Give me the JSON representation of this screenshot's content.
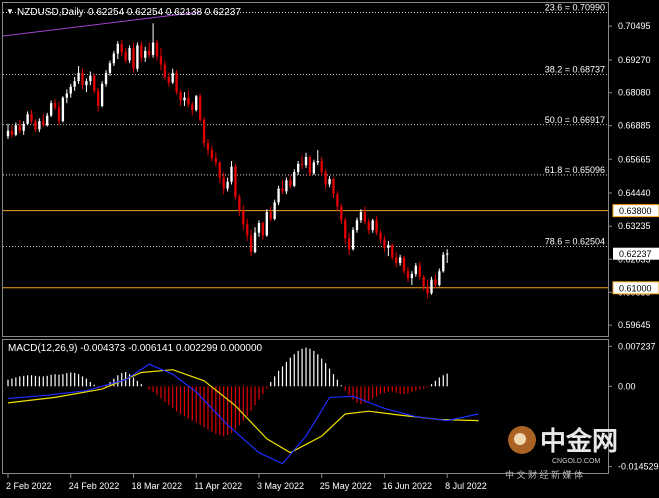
{
  "header": {
    "symbol_label": "NZDUSD,Daily",
    "ohlc_label": "0.62254 0.62254 0.62138 0.62237"
  },
  "macd_header": {
    "label": "MACD(12,26,9) -0.004373 -0.006141 0.002299 0.000000"
  },
  "colors": {
    "bull": "#ffffff",
    "bear": "#e00000",
    "fib_line": "#ffffff",
    "hline": "#f5a623",
    "macd_line": "#1e2cff",
    "signal_line": "#f0e000",
    "top_line": "#a040d0",
    "label_box_bg": "#ffffff",
    "label_box_text": "#000000",
    "current_price_box_bg": "#ffffff"
  },
  "fib_levels": [
    {
      "label": "23.6 = 0.70990",
      "price": 0.7099
    },
    {
      "label": "38.2 = 0.68737",
      "price": 0.68737
    },
    {
      "label": "50.0 = 0.66917",
      "price": 0.66917
    },
    {
      "label": "61.8 = 0.65096",
      "price": 0.65096
    },
    {
      "label": "78.6 = 0.62504",
      "price": 0.62504
    }
  ],
  "horizontal_lines": [
    {
      "label": "0.63800",
      "price": 0.638
    },
    {
      "label": "0.61000",
      "price": 0.61
    }
  ],
  "current_price": {
    "label": "0.62237",
    "price": 0.62237
  },
  "price_axis_ticks": [
    {
      "label": "0.70495",
      "price": 0.70495
    },
    {
      "label": "0.69270",
      "price": 0.6927
    },
    {
      "label": "0.68080",
      "price": 0.6808
    },
    {
      "label": "0.66885",
      "price": 0.66885
    },
    {
      "label": "0.65665",
      "price": 0.65665
    },
    {
      "label": "0.64440",
      "price": 0.6444
    },
    {
      "label": "0.63235",
      "price": 0.63235
    },
    {
      "label": "0.62035",
      "price": 0.62035
    },
    {
      "label": "0.60835",
      "price": 0.60835
    },
    {
      "label": "0.59645",
      "price": 0.59645
    }
  ],
  "macd_axis_ticks": [
    {
      "label": "0.007237",
      "value": 0.007237
    },
    {
      "label": "0.00",
      "value": 0.0
    },
    {
      "label": "-0.014529",
      "value": -0.014529
    }
  ],
  "date_ticks": [
    {
      "label": "2 Feb 2022",
      "index": 0
    },
    {
      "label": "24 Feb 2022",
      "index": 16
    },
    {
      "label": "18 Mar 2022",
      "index": 32
    },
    {
      "label": "11 Apr 2022",
      "index": 48
    },
    {
      "label": "3 May 2022",
      "index": 64
    },
    {
      "label": "25 May 2022",
      "index": 80
    },
    {
      "label": "16 Jun 2022",
      "index": 96
    },
    {
      "label": "8 Jul 2022",
      "index": 112
    }
  ],
  "watermark": {
    "brand": "中金网",
    "site": "CNGOLD.COM",
    "tagline": "中 文 财 经 新 媒 体"
  },
  "chart_data": {
    "type": "candlestick",
    "title": "NZDUSD,Daily",
    "price_range": [
      0.5925,
      0.713
    ],
    "macd_range": [
      -0.0155,
      0.0082
    ],
    "candles": [
      [
        0.665,
        0.6695,
        0.664,
        0.667
      ],
      [
        0.667,
        0.669,
        0.6645,
        0.6655
      ],
      [
        0.6655,
        0.67,
        0.665,
        0.669
      ],
      [
        0.669,
        0.671,
        0.666,
        0.667
      ],
      [
        0.667,
        0.6705,
        0.6655,
        0.6695
      ],
      [
        0.6695,
        0.674,
        0.669,
        0.673
      ],
      [
        0.673,
        0.6745,
        0.6695,
        0.6705
      ],
      [
        0.6705,
        0.6712,
        0.6665,
        0.6675
      ],
      [
        0.6675,
        0.6715,
        0.6665,
        0.6705
      ],
      [
        0.6705,
        0.673,
        0.6685,
        0.669
      ],
      [
        0.669,
        0.6735,
        0.6685,
        0.6725
      ],
      [
        0.6725,
        0.678,
        0.672,
        0.677
      ],
      [
        0.677,
        0.6785,
        0.6745,
        0.6755
      ],
      [
        0.6755,
        0.6775,
        0.669,
        0.6705
      ],
      [
        0.6705,
        0.6795,
        0.67,
        0.679
      ],
      [
        0.679,
        0.682,
        0.677,
        0.6805
      ],
      [
        0.6805,
        0.684,
        0.679,
        0.683
      ],
      [
        0.683,
        0.6865,
        0.6815,
        0.685
      ],
      [
        0.685,
        0.6905,
        0.684,
        0.688
      ],
      [
        0.688,
        0.6895,
        0.682,
        0.6835
      ],
      [
        0.6835,
        0.686,
        0.681,
        0.685
      ],
      [
        0.685,
        0.6885,
        0.6835,
        0.687
      ],
      [
        0.687,
        0.6875,
        0.6805,
        0.6815
      ],
      [
        0.6815,
        0.6825,
        0.674,
        0.676
      ],
      [
        0.676,
        0.685,
        0.6755,
        0.684
      ],
      [
        0.684,
        0.689,
        0.683,
        0.688
      ],
      [
        0.688,
        0.6925,
        0.687,
        0.6915
      ],
      [
        0.6915,
        0.696,
        0.6905,
        0.695
      ],
      [
        0.695,
        0.6995,
        0.693,
        0.6985
      ],
      [
        0.6985,
        0.7,
        0.694,
        0.6955
      ],
      [
        0.6955,
        0.697,
        0.6915,
        0.6925
      ],
      [
        0.6925,
        0.698,
        0.6915,
        0.697
      ],
      [
        0.697,
        0.699,
        0.688,
        0.6895
      ],
      [
        0.6895,
        0.699,
        0.6885,
        0.698
      ],
      [
        0.698,
        0.6995,
        0.692,
        0.6935
      ],
      [
        0.6935,
        0.6975,
        0.692,
        0.696
      ],
      [
        0.696,
        0.699,
        0.6935,
        0.6945
      ],
      [
        0.6945,
        0.706,
        0.6935,
        0.699
      ],
      [
        0.699,
        0.7,
        0.6925,
        0.694
      ],
      [
        0.694,
        0.697,
        0.689,
        0.691
      ],
      [
        0.691,
        0.6925,
        0.6855,
        0.6865
      ],
      [
        0.6865,
        0.688,
        0.683,
        0.6845
      ],
      [
        0.6845,
        0.6895,
        0.684,
        0.688
      ],
      [
        0.688,
        0.689,
        0.68,
        0.681
      ],
      [
        0.681,
        0.682,
        0.676,
        0.678
      ],
      [
        0.678,
        0.681,
        0.676,
        0.679
      ],
      [
        0.679,
        0.6815,
        0.6755,
        0.6765
      ],
      [
        0.6765,
        0.6775,
        0.6725,
        0.6745
      ],
      [
        0.6745,
        0.68,
        0.674,
        0.6795
      ],
      [
        0.6795,
        0.6805,
        0.67,
        0.671
      ],
      [
        0.671,
        0.672,
        0.661,
        0.6625
      ],
      [
        0.6625,
        0.664,
        0.658,
        0.66
      ],
      [
        0.66,
        0.6615,
        0.656,
        0.657
      ],
      [
        0.657,
        0.659,
        0.654,
        0.6555
      ],
      [
        0.6555,
        0.656,
        0.648,
        0.65
      ],
      [
        0.65,
        0.652,
        0.644,
        0.646
      ],
      [
        0.646,
        0.65,
        0.645,
        0.6485
      ],
      [
        0.6485,
        0.656,
        0.6475,
        0.654
      ],
      [
        0.654,
        0.655,
        0.642,
        0.643
      ],
      [
        0.643,
        0.644,
        0.636,
        0.638
      ],
      [
        0.638,
        0.64,
        0.631,
        0.633
      ],
      [
        0.633,
        0.635,
        0.627,
        0.629
      ],
      [
        0.629,
        0.631,
        0.6215,
        0.623
      ],
      [
        0.623,
        0.632,
        0.6225,
        0.63
      ],
      [
        0.63,
        0.6345,
        0.6285,
        0.6335
      ],
      [
        0.6335,
        0.634,
        0.6275,
        0.629
      ],
      [
        0.629,
        0.6385,
        0.6285,
        0.6375
      ],
      [
        0.6375,
        0.6395,
        0.634,
        0.635
      ],
      [
        0.635,
        0.642,
        0.6345,
        0.641
      ],
      [
        0.641,
        0.647,
        0.64,
        0.646
      ],
      [
        0.646,
        0.649,
        0.644,
        0.645
      ],
      [
        0.645,
        0.65,
        0.644,
        0.649
      ],
      [
        0.649,
        0.651,
        0.646,
        0.647
      ],
      [
        0.647,
        0.653,
        0.6465,
        0.652
      ],
      [
        0.652,
        0.656,
        0.651,
        0.655
      ],
      [
        0.655,
        0.658,
        0.653,
        0.6545
      ],
      [
        0.6545,
        0.659,
        0.6535,
        0.6575
      ],
      [
        0.6575,
        0.658,
        0.6505,
        0.6515
      ],
      [
        0.6515,
        0.6565,
        0.651,
        0.6555
      ],
      [
        0.6555,
        0.66,
        0.6545,
        0.656
      ],
      [
        0.656,
        0.6575,
        0.6505,
        0.652
      ],
      [
        0.652,
        0.653,
        0.646,
        0.6475
      ],
      [
        0.6475,
        0.6505,
        0.6465,
        0.6495
      ],
      [
        0.6495,
        0.65,
        0.6425,
        0.644
      ],
      [
        0.644,
        0.645,
        0.638,
        0.6395
      ],
      [
        0.6395,
        0.6405,
        0.633,
        0.6345
      ],
      [
        0.6345,
        0.6355,
        0.626,
        0.628
      ],
      [
        0.628,
        0.63,
        0.622,
        0.624
      ],
      [
        0.624,
        0.632,
        0.6235,
        0.631
      ],
      [
        0.631,
        0.6355,
        0.63,
        0.6345
      ],
      [
        0.6345,
        0.6385,
        0.6335,
        0.6375
      ],
      [
        0.6375,
        0.6395,
        0.633,
        0.634
      ],
      [
        0.634,
        0.635,
        0.6295,
        0.631
      ],
      [
        0.631,
        0.635,
        0.63,
        0.6345
      ],
      [
        0.6345,
        0.636,
        0.629,
        0.63
      ],
      [
        0.63,
        0.631,
        0.626,
        0.6275
      ],
      [
        0.6275,
        0.629,
        0.623,
        0.6245
      ],
      [
        0.6245,
        0.627,
        0.6215,
        0.6255
      ],
      [
        0.6255,
        0.626,
        0.62,
        0.621
      ],
      [
        0.621,
        0.623,
        0.6175,
        0.619
      ],
      [
        0.619,
        0.622,
        0.618,
        0.621
      ],
      [
        0.621,
        0.6215,
        0.615,
        0.616
      ],
      [
        0.616,
        0.6175,
        0.612,
        0.6135
      ],
      [
        0.6135,
        0.616,
        0.611,
        0.615
      ],
      [
        0.615,
        0.619,
        0.614,
        0.618
      ],
      [
        0.618,
        0.6195,
        0.613,
        0.614
      ],
      [
        0.614,
        0.6145,
        0.609,
        0.6105
      ],
      [
        0.6105,
        0.613,
        0.606,
        0.608
      ],
      [
        0.608,
        0.614,
        0.6075,
        0.613
      ],
      [
        0.613,
        0.615,
        0.61,
        0.611
      ],
      [
        0.611,
        0.617,
        0.6105,
        0.616
      ],
      [
        0.616,
        0.623,
        0.6155,
        0.622
      ],
      [
        0.622,
        0.624,
        0.619,
        0.6224
      ]
    ],
    "macd_histogram": [
      0.0012,
      0.0014,
      0.0016,
      0.0018,
      0.0019,
      0.002,
      0.002,
      0.0019,
      0.0018,
      0.0018,
      0.0019,
      0.0021,
      0.0022,
      0.0021,
      0.0022,
      0.0024,
      0.0025,
      0.0024,
      0.0022,
      0.0018,
      0.0014,
      0.0008,
      0.0003,
      -0.0004,
      -0.0002,
      0.0002,
      0.0008,
      0.0014,
      0.002,
      0.0024,
      0.0026,
      0.0022,
      0.0016,
      0.001,
      0.0004,
      0.0,
      -0.0006,
      -0.001,
      -0.0016,
      -0.0022,
      -0.0028,
      -0.0034,
      -0.004,
      -0.0046,
      -0.005,
      -0.0054,
      -0.0058,
      -0.0062,
      -0.0066,
      -0.007,
      -0.0074,
      -0.0078,
      -0.0082,
      -0.0086,
      -0.0088,
      -0.009,
      -0.0088,
      -0.0084,
      -0.0078,
      -0.007,
      -0.0062,
      -0.0054,
      -0.0044,
      -0.0034,
      -0.0024,
      -0.0014,
      -0.0004,
      0.0008,
      0.0018,
      0.0028,
      0.0036,
      0.0044,
      0.0052,
      0.0058,
      0.0064,
      0.0068,
      0.007,
      0.0068,
      0.0064,
      0.0058,
      0.005,
      0.0042,
      0.0032,
      0.0022,
      0.0012,
      0.0002,
      -0.0008,
      -0.0016,
      -0.0024,
      -0.003,
      -0.0032,
      -0.003,
      -0.0026,
      -0.0022,
      -0.0018,
      -0.0014,
      -0.0012,
      -0.001,
      -0.001,
      -0.0012,
      -0.0014,
      -0.0014,
      -0.0012,
      -0.001,
      -0.0008,
      -0.0006,
      -0.0004,
      -0.0002,
      0.0004,
      0.001,
      0.0016,
      0.002,
      0.0023
    ],
    "macd_line_points": [
      [
        0,
        -0.0022
      ],
      [
        10,
        -0.0016
      ],
      [
        20,
        -0.0008
      ],
      [
        30,
        0.0012
      ],
      [
        36,
        0.004
      ],
      [
        42,
        0.0022
      ],
      [
        48,
        -0.001
      ],
      [
        56,
        -0.007
      ],
      [
        64,
        -0.012
      ],
      [
        70,
        -0.014
      ],
      [
        76,
        -0.009
      ],
      [
        82,
        -0.002
      ],
      [
        88,
        -0.0018
      ],
      [
        96,
        -0.004
      ],
      [
        104,
        -0.0055
      ],
      [
        112,
        -0.0062
      ],
      [
        120,
        -0.005
      ]
    ],
    "signal_line_points": [
      [
        0,
        -0.003
      ],
      [
        12,
        -0.002
      ],
      [
        24,
        -0.0005
      ],
      [
        34,
        0.0025
      ],
      [
        42,
        0.003
      ],
      [
        50,
        0.001
      ],
      [
        58,
        -0.0035
      ],
      [
        66,
        -0.0095
      ],
      [
        72,
        -0.012
      ],
      [
        80,
        -0.009
      ],
      [
        86,
        -0.005
      ],
      [
        92,
        -0.0045
      ],
      [
        100,
        -0.0052
      ],
      [
        110,
        -0.006
      ],
      [
        120,
        -0.0062
      ]
    ]
  }
}
